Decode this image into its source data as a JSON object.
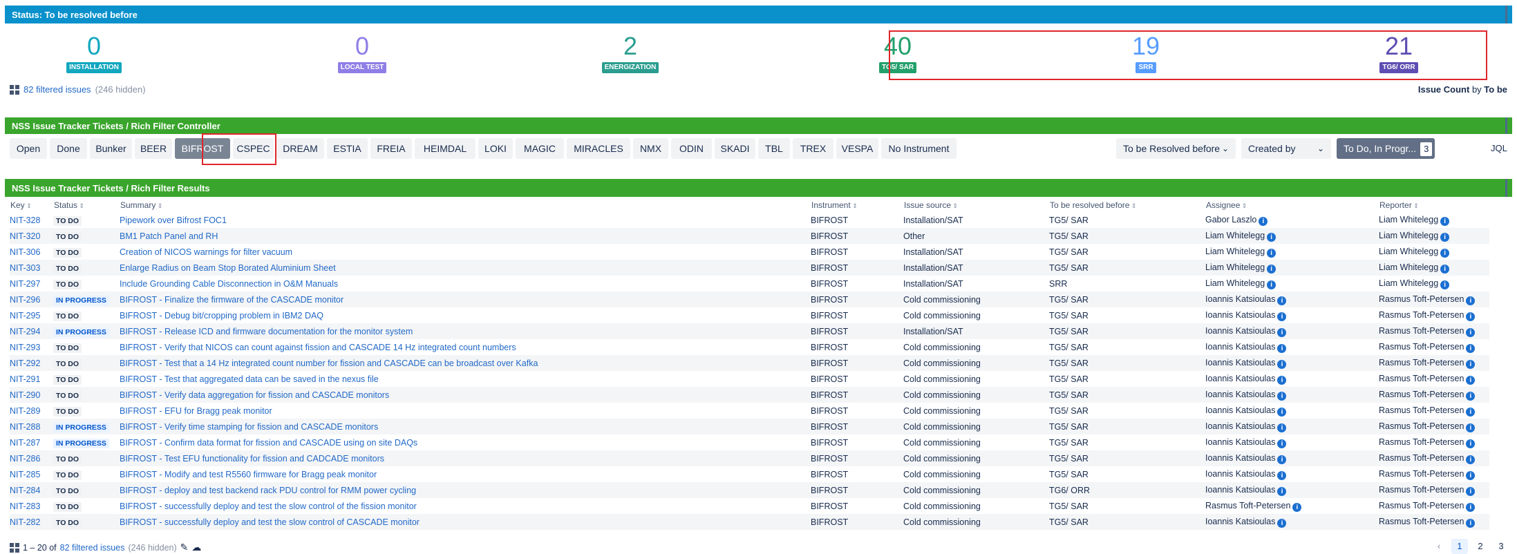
{
  "status_panel": {
    "title": "Status: To be resolved before",
    "counters": [
      {
        "value": "0",
        "label": "INSTALLATION",
        "color": "#12a7bf",
        "badge": "#12a7bf"
      },
      {
        "value": "0",
        "label": "LOCAL TEST",
        "color": "#8f7ee7",
        "badge": "#8f7ee7"
      },
      {
        "value": "2",
        "label": "ENERGIZATION",
        "color": "#2a9d8f",
        "badge": "#2a9d8f"
      },
      {
        "value": "40",
        "label": "TG5/ SAR",
        "color": "#22a06b",
        "badge": "#22a06b"
      },
      {
        "value": "19",
        "label": "SRR",
        "color": "#579dff",
        "badge": "#579dff"
      },
      {
        "value": "21",
        "label": "TG6/ ORR",
        "color": "#5e4db2",
        "badge": "#5e4db2"
      }
    ],
    "filtered_link": "82 filtered issues",
    "hidden": "(246 hidden)",
    "issue_count_bold": "Issue Count",
    "issue_count_by": " by ",
    "issue_count_field": "To be"
  },
  "controller_panel": {
    "title": "NSS Issue Tracker Tickets / Rich Filter Controller",
    "buttons": [
      "Open",
      "Done",
      "Bunker",
      "BEER",
      "BIFROST",
      "CSPEC",
      "DREAM",
      "ESTIA",
      "FREIA",
      "HEIMDAL",
      "LOKI",
      "MAGIC",
      "MIRACLES",
      "NMX",
      "ODIN",
      "SKADI",
      "TBL",
      "TREX",
      "VESPA",
      "No Instrument"
    ],
    "selected": "BIFROST",
    "dropdown_resolved": "To be Resolved before",
    "dropdown_created": "Created by",
    "status_filter": "To Do, In Progr...",
    "status_filter_count": "3",
    "jql": "JQL"
  },
  "results_panel": {
    "title": "NSS Issue Tracker Tickets / Rich Filter Results",
    "columns": [
      "Key",
      "Status",
      "Summary",
      "Instrument",
      "Issue source",
      "To be resolved before",
      "Assignee",
      "Reporter"
    ],
    "rows": [
      [
        "NIT-328",
        "TO DO",
        "Pipework over Bifrost FOC1",
        "BIFROST",
        "Installation/SAT",
        "TG5/ SAR",
        "Gabor Laszlo",
        "Liam Whitelegg"
      ],
      [
        "NIT-320",
        "TO DO",
        "BM1 Patch Panel and RH",
        "BIFROST",
        "Other",
        "TG5/ SAR",
        "Liam Whitelegg",
        "Liam Whitelegg"
      ],
      [
        "NIT-306",
        "TO DO",
        "Creation of NICOS warnings for filter vacuum",
        "BIFROST",
        "Installation/SAT",
        "TG5/ SAR",
        "Liam Whitelegg",
        "Liam Whitelegg"
      ],
      [
        "NIT-303",
        "TO DO",
        "Enlarge Radius on Beam Stop Borated Aluminium Sheet",
        "BIFROST",
        "Installation/SAT",
        "TG5/ SAR",
        "Liam Whitelegg",
        "Liam Whitelegg"
      ],
      [
        "NIT-297",
        "TO DO",
        "Include Grounding Cable Disconnection in O&M Manuals",
        "BIFROST",
        "Installation/SAT",
        "SRR",
        "Liam Whitelegg",
        "Liam Whitelegg"
      ],
      [
        "NIT-296",
        "IN PROGRESS",
        "BIFROST - Finalize the firmware of the CASCADE monitor",
        "BIFROST",
        "Cold commissioning",
        "TG5/ SAR",
        "Ioannis Katsioulas",
        "Rasmus Toft-Petersen"
      ],
      [
        "NIT-295",
        "TO DO",
        "BIFROST - Debug bit/cropping problem in IBM2 DAQ",
        "BIFROST",
        "Cold commissioning",
        "TG5/ SAR",
        "Ioannis Katsioulas",
        "Rasmus Toft-Petersen"
      ],
      [
        "NIT-294",
        "IN PROGRESS",
        "BIFROST - Release ICD and firmware documentation for the monitor system",
        "BIFROST",
        "Installation/SAT",
        "TG5/ SAR",
        "Ioannis Katsioulas",
        "Rasmus Toft-Petersen"
      ],
      [
        "NIT-293",
        "TO DO",
        "BIFROST - Verify that NICOS can count against fission and CASCADE 14 Hz integrated count numbers",
        "BIFROST",
        "Cold commissioning",
        "TG5/ SAR",
        "Ioannis Katsioulas",
        "Rasmus Toft-Petersen"
      ],
      [
        "NIT-292",
        "TO DO",
        "BIFROST - Test that a 14 Hz integrated count number for fission and CASCADE can be broadcast over Kafka",
        "BIFROST",
        "Cold commissioning",
        "TG5/ SAR",
        "Ioannis Katsioulas",
        "Rasmus Toft-Petersen"
      ],
      [
        "NIT-291",
        "TO DO",
        "BIFROST - Test that aggregated data can be saved in the nexus file",
        "BIFROST",
        "Cold commissioning",
        "TG5/ SAR",
        "Ioannis Katsioulas",
        "Rasmus Toft-Petersen"
      ],
      [
        "NIT-290",
        "TO DO",
        "BIFROST - Verify data aggregation for fission and CASCADE monitors",
        "BIFROST",
        "Cold commissioning",
        "TG5/ SAR",
        "Ioannis Katsioulas",
        "Rasmus Toft-Petersen"
      ],
      [
        "NIT-289",
        "TO DO",
        "BIFROST - EFU for Bragg peak monitor",
        "BIFROST",
        "Cold commissioning",
        "TG5/ SAR",
        "Ioannis Katsioulas",
        "Rasmus Toft-Petersen"
      ],
      [
        "NIT-288",
        "IN PROGRESS",
        "BIFROST - Verify time stamping for fission and CASCADE monitors",
        "BIFROST",
        "Cold commissioning",
        "TG5/ SAR",
        "Ioannis Katsioulas",
        "Rasmus Toft-Petersen"
      ],
      [
        "NIT-287",
        "IN PROGRESS",
        "BIFROST - Confirm data format for fission and CASCADE using on site DAQs",
        "BIFROST",
        "Cold commissioning",
        "TG5/ SAR",
        "Ioannis Katsioulas",
        "Rasmus Toft-Petersen"
      ],
      [
        "NIT-286",
        "TO DO",
        "BIFROST - Test EFU functionality for fission and CADCADE monitors",
        "BIFROST",
        "Cold commissioning",
        "TG5/ SAR",
        "Ioannis Katsioulas",
        "Rasmus Toft-Petersen"
      ],
      [
        "NIT-285",
        "TO DO",
        "BIFROST - Modify and test R5560 firmware for Bragg peak monitor",
        "BIFROST",
        "Cold commissioning",
        "TG5/ SAR",
        "Ioannis Katsioulas",
        "Rasmus Toft-Petersen"
      ],
      [
        "NIT-284",
        "TO DO",
        "BIFROST - deploy and test backend rack PDU control for RMM power cycling",
        "BIFROST",
        "Cold commissioning",
        "TG6/ ORR",
        "Ioannis Katsioulas",
        "Rasmus Toft-Petersen"
      ],
      [
        "NIT-283",
        "TO DO",
        "BIFROST - successfully deploy and test the slow control of the fission monitor",
        "BIFROST",
        "Cold commissioning",
        "TG5/ SAR",
        "Rasmus Toft-Petersen",
        "Rasmus Toft-Petersen"
      ],
      [
        "NIT-282",
        "TO DO",
        "BIFROST - successfully deploy and test the slow control of CASCADE monitor",
        "BIFROST",
        "Cold commissioning",
        "TG5/ SAR",
        "Ioannis Katsioulas",
        "Rasmus Toft-Petersen"
      ]
    ],
    "footer_range": "1 – 20 of ",
    "footer_link": "82 filtered issues",
    "footer_hidden": "(246 hidden)",
    "pages": [
      "1",
      "2",
      "3"
    ]
  }
}
